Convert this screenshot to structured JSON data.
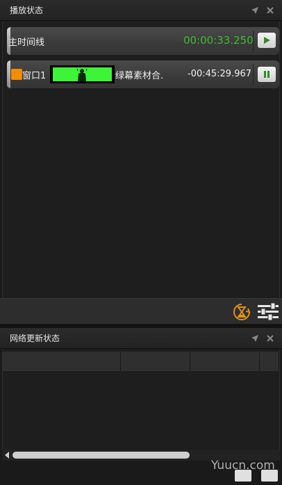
{
  "panel1": {
    "title": "播放状态",
    "pin_icon": "pin-icon",
    "close_icon": "close-icon"
  },
  "main_timeline": {
    "label": "主时间线",
    "timecode": "00:00:33.250",
    "timecode_color": "#3dbb2f",
    "button_icon": "play-icon"
  },
  "window_track": {
    "swatch_color": "#f28c00",
    "label": "窗口1",
    "clip_name": "绿幕素材合.",
    "timecode": "-00:45:29.967",
    "button_icon": "pause-icon",
    "thumbnail_color": "#3cf536"
  },
  "toolbar": {
    "icons": [
      "hourglass-refresh-icon",
      "mixer-sliders-icon"
    ],
    "accent": "#e0901a"
  },
  "panel2": {
    "title": "网络更新状态",
    "pin_icon": "pin-icon",
    "close_icon": "close-icon",
    "columns": [
      "",
      "",
      "",
      ""
    ]
  },
  "watermark": "Yuucn.com"
}
